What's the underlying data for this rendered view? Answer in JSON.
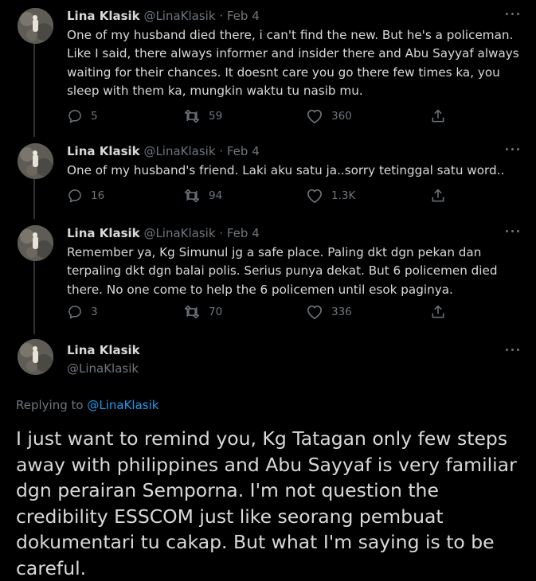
{
  "colors": {
    "background": "#000000",
    "text": "#d9d9d9",
    "muted": "#6e767d",
    "link": "#1d9bf0"
  },
  "tweets": [
    {
      "name": "Lina Klasik",
      "handle": "@LinaKlasik",
      "separator": "·",
      "date": "Feb 4",
      "text": "One of my husband died there, i can't find the new. But he's a policeman. Like I said, there always informer and insider there and Abu Sayyaf always waiting for their chances. It doesnt care you go there few times ka, you sleep with them ka, mungkin waktu tu nasib mu.",
      "replies": "5",
      "retweets": "59",
      "likes": "360"
    },
    {
      "name": "Lina Klasik",
      "handle": "@LinaKlasik",
      "separator": "·",
      "date": "Feb 4",
      "text": "One of my husband's friend. Laki aku satu ja..sorry tetinggal satu word..",
      "replies": "16",
      "retweets": "94",
      "likes": "1.3K"
    },
    {
      "name": "Lina Klasik",
      "handle": "@LinaKlasik",
      "separator": "·",
      "date": "Feb 4",
      "text": "Remember ya, Kg Simunul jg a safe place. Paling dkt dgn pekan dan terpaling dkt dgn balai polis. Serius punya dekat. But 6 policemen died there. No one come to help the 6 policemen until esok paginya.",
      "replies": "3",
      "retweets": "70",
      "likes": "336"
    }
  ],
  "main_tweet": {
    "name": "Lina Klasik",
    "handle": "@LinaKlasik",
    "replying_prefix": "Replying to",
    "replying_to": "@LinaKlasik",
    "text": "I just want to remind you, Kg Tatagan only few steps away with philippines and Abu Sayyaf is very familiar dgn perairan Semporna. I'm not question the credibility ESSCOM just like seorang pembuat dokumentari tu cakap. But what I'm saying is to be careful."
  },
  "icons": {
    "reply": "reply-icon",
    "retweet": "retweet-icon",
    "like": "like-icon",
    "share": "share-icon",
    "more": "more-icon"
  }
}
